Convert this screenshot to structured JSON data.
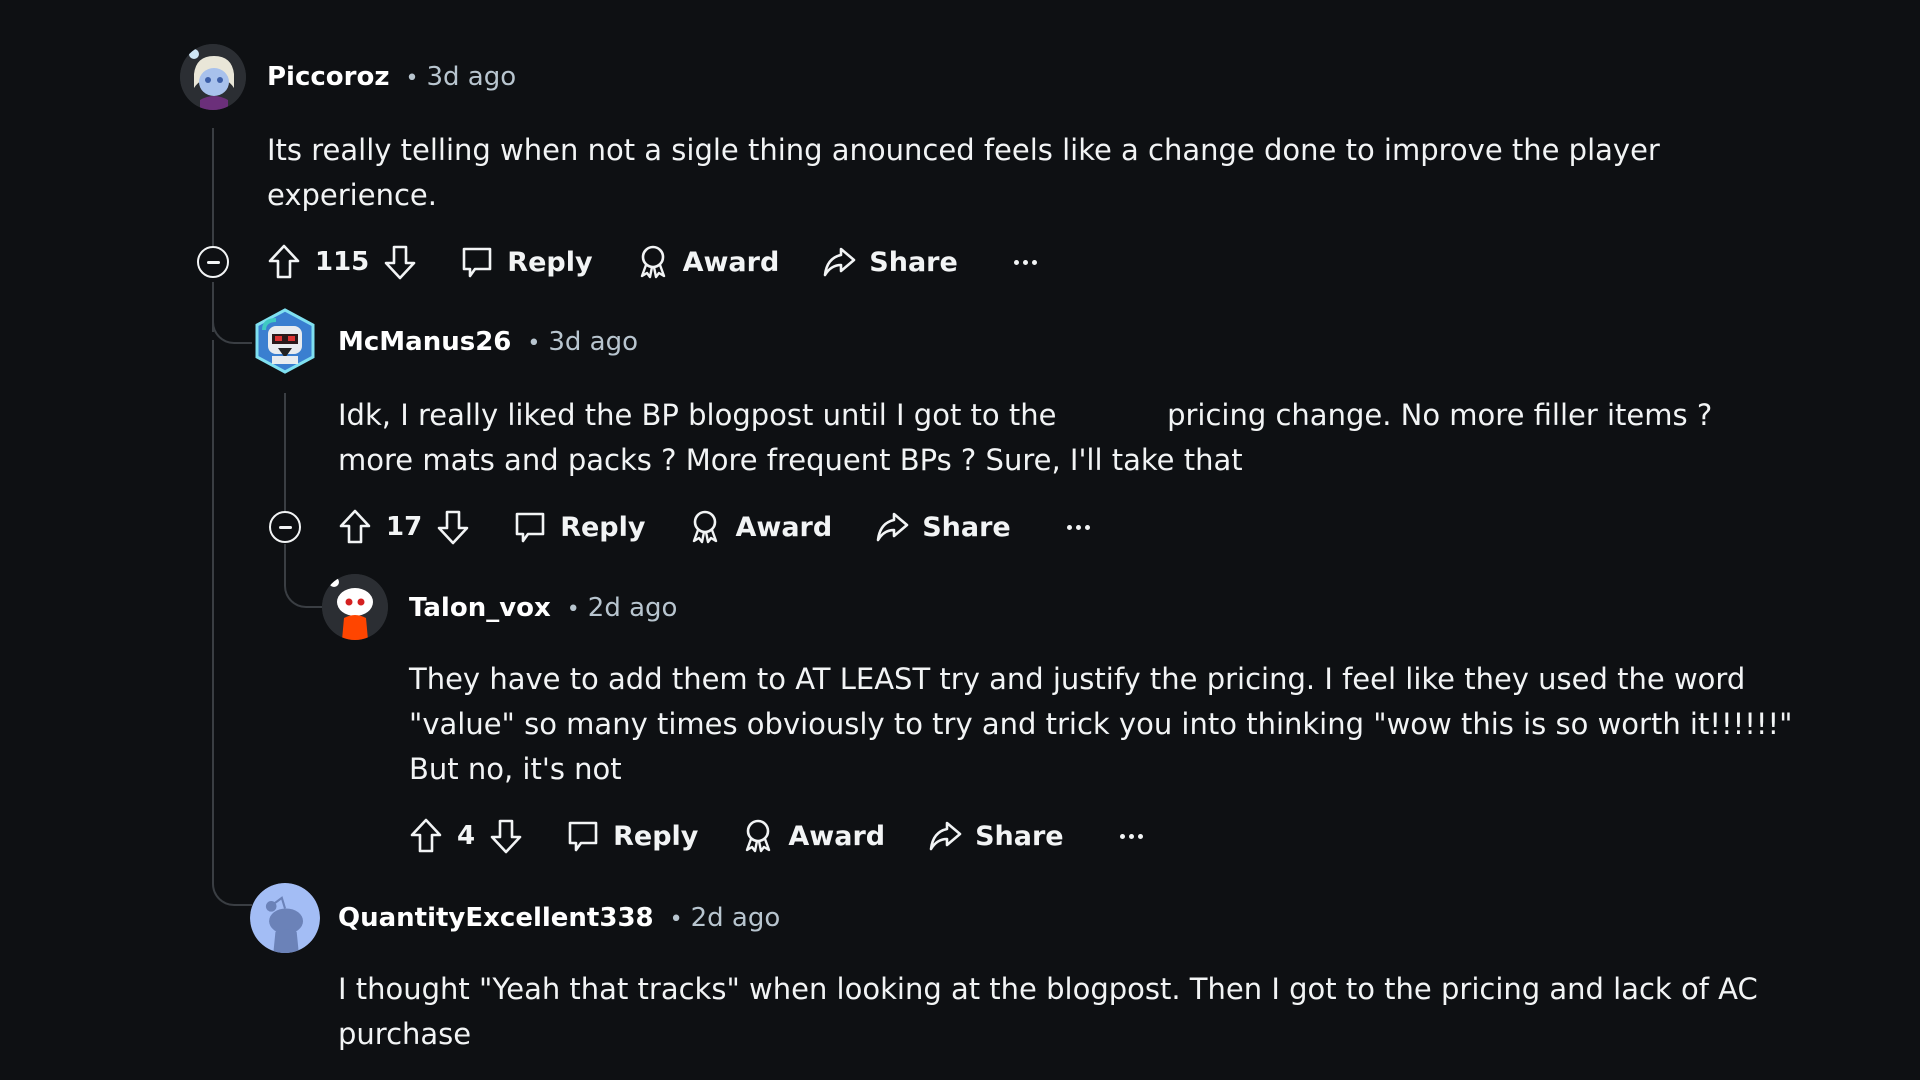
{
  "comments": [
    {
      "username": "Piccoroz",
      "separator": "•",
      "time": "3d ago",
      "avatar": "anime-character-avatar",
      "body": "Its really telling when not a sigle thing anounced feels like a change done to improve the player\nexperience.",
      "votes": "115",
      "collapsible": true,
      "actions": {
        "reply": "Reply",
        "award": "Award",
        "share": "Share",
        "more": "more-options"
      }
    },
    {
      "username": "McManus26",
      "separator": "•",
      "time": "3d ago",
      "avatar": "robot-hexagon-avatar",
      "body": "Idk, I really liked the BP blogpost until I got to the            pricing change. No more filler items ?\nmore mats and packs ? More frequent BPs ? Sure, I'll take that",
      "votes": "17",
      "collapsible": true,
      "actions": {
        "reply": "Reply",
        "award": "Award",
        "share": "Share",
        "more": "more-options"
      }
    },
    {
      "username": "Talon_vox",
      "separator": "•",
      "time": "2d ago",
      "avatar": "snoo-orange-hoodie-avatar",
      "body": "They have to add them to AT LEAST try and justify the pricing. I feel like they used the word\n\"value\" so many times obviously to try and trick you into thinking \"wow this is so worth it!!!!!!\"\nBut no, it's not",
      "votes": "4",
      "collapsible": false,
      "actions": {
        "reply": "Reply",
        "award": "Award",
        "share": "Share",
        "more": "more-options"
      }
    },
    {
      "username": "QuantityExcellent338",
      "separator": "•",
      "time": "2d ago",
      "avatar": "default-snoo-blue-avatar",
      "body": "I thought \"Yeah that tracks\" when looking at the blogpost. Then I got to the pricing and lack of AC\npurchase"
    }
  ],
  "colors": {
    "background": "#0e1013",
    "text": "#f2f4f5",
    "meta": "#b8c5cf",
    "thread_line": "#3a3e43"
  }
}
